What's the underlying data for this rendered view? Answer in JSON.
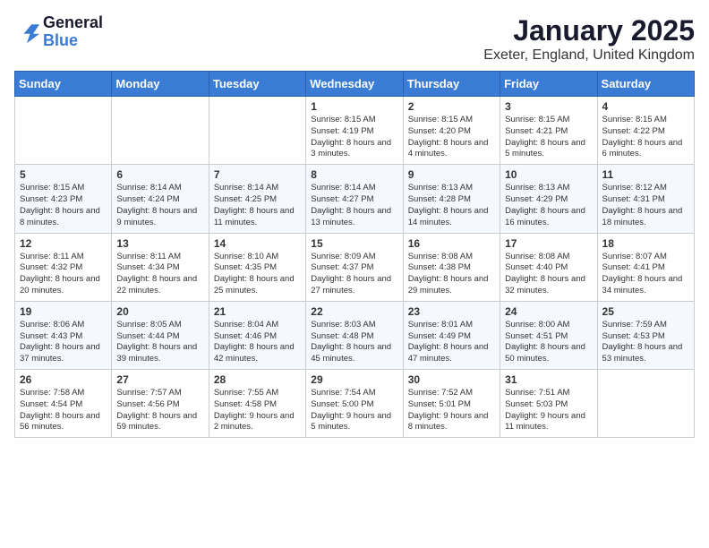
{
  "logo": {
    "general": "General",
    "blue": "Blue"
  },
  "title": {
    "month_year": "January 2025",
    "location": "Exeter, England, United Kingdom"
  },
  "days_of_week": [
    "Sunday",
    "Monday",
    "Tuesday",
    "Wednesday",
    "Thursday",
    "Friday",
    "Saturday"
  ],
  "weeks": [
    [
      {
        "day": "",
        "sunrise": "",
        "sunset": "",
        "daylight": ""
      },
      {
        "day": "",
        "sunrise": "",
        "sunset": "",
        "daylight": ""
      },
      {
        "day": "",
        "sunrise": "",
        "sunset": "",
        "daylight": ""
      },
      {
        "day": "1",
        "sunrise": "Sunrise: 8:15 AM",
        "sunset": "Sunset: 4:19 PM",
        "daylight": "Daylight: 8 hours and 3 minutes."
      },
      {
        "day": "2",
        "sunrise": "Sunrise: 8:15 AM",
        "sunset": "Sunset: 4:20 PM",
        "daylight": "Daylight: 8 hours and 4 minutes."
      },
      {
        "day": "3",
        "sunrise": "Sunrise: 8:15 AM",
        "sunset": "Sunset: 4:21 PM",
        "daylight": "Daylight: 8 hours and 5 minutes."
      },
      {
        "day": "4",
        "sunrise": "Sunrise: 8:15 AM",
        "sunset": "Sunset: 4:22 PM",
        "daylight": "Daylight: 8 hours and 6 minutes."
      }
    ],
    [
      {
        "day": "5",
        "sunrise": "Sunrise: 8:15 AM",
        "sunset": "Sunset: 4:23 PM",
        "daylight": "Daylight: 8 hours and 8 minutes."
      },
      {
        "day": "6",
        "sunrise": "Sunrise: 8:14 AM",
        "sunset": "Sunset: 4:24 PM",
        "daylight": "Daylight: 8 hours and 9 minutes."
      },
      {
        "day": "7",
        "sunrise": "Sunrise: 8:14 AM",
        "sunset": "Sunset: 4:25 PM",
        "daylight": "Daylight: 8 hours and 11 minutes."
      },
      {
        "day": "8",
        "sunrise": "Sunrise: 8:14 AM",
        "sunset": "Sunset: 4:27 PM",
        "daylight": "Daylight: 8 hours and 13 minutes."
      },
      {
        "day": "9",
        "sunrise": "Sunrise: 8:13 AM",
        "sunset": "Sunset: 4:28 PM",
        "daylight": "Daylight: 8 hours and 14 minutes."
      },
      {
        "day": "10",
        "sunrise": "Sunrise: 8:13 AM",
        "sunset": "Sunset: 4:29 PM",
        "daylight": "Daylight: 8 hours and 16 minutes."
      },
      {
        "day": "11",
        "sunrise": "Sunrise: 8:12 AM",
        "sunset": "Sunset: 4:31 PM",
        "daylight": "Daylight: 8 hours and 18 minutes."
      }
    ],
    [
      {
        "day": "12",
        "sunrise": "Sunrise: 8:11 AM",
        "sunset": "Sunset: 4:32 PM",
        "daylight": "Daylight: 8 hours and 20 minutes."
      },
      {
        "day": "13",
        "sunrise": "Sunrise: 8:11 AM",
        "sunset": "Sunset: 4:34 PM",
        "daylight": "Daylight: 8 hours and 22 minutes."
      },
      {
        "day": "14",
        "sunrise": "Sunrise: 8:10 AM",
        "sunset": "Sunset: 4:35 PM",
        "daylight": "Daylight: 8 hours and 25 minutes."
      },
      {
        "day": "15",
        "sunrise": "Sunrise: 8:09 AM",
        "sunset": "Sunset: 4:37 PM",
        "daylight": "Daylight: 8 hours and 27 minutes."
      },
      {
        "day": "16",
        "sunrise": "Sunrise: 8:08 AM",
        "sunset": "Sunset: 4:38 PM",
        "daylight": "Daylight: 8 hours and 29 minutes."
      },
      {
        "day": "17",
        "sunrise": "Sunrise: 8:08 AM",
        "sunset": "Sunset: 4:40 PM",
        "daylight": "Daylight: 8 hours and 32 minutes."
      },
      {
        "day": "18",
        "sunrise": "Sunrise: 8:07 AM",
        "sunset": "Sunset: 4:41 PM",
        "daylight": "Daylight: 8 hours and 34 minutes."
      }
    ],
    [
      {
        "day": "19",
        "sunrise": "Sunrise: 8:06 AM",
        "sunset": "Sunset: 4:43 PM",
        "daylight": "Daylight: 8 hours and 37 minutes."
      },
      {
        "day": "20",
        "sunrise": "Sunrise: 8:05 AM",
        "sunset": "Sunset: 4:44 PM",
        "daylight": "Daylight: 8 hours and 39 minutes."
      },
      {
        "day": "21",
        "sunrise": "Sunrise: 8:04 AM",
        "sunset": "Sunset: 4:46 PM",
        "daylight": "Daylight: 8 hours and 42 minutes."
      },
      {
        "day": "22",
        "sunrise": "Sunrise: 8:03 AM",
        "sunset": "Sunset: 4:48 PM",
        "daylight": "Daylight: 8 hours and 45 minutes."
      },
      {
        "day": "23",
        "sunrise": "Sunrise: 8:01 AM",
        "sunset": "Sunset: 4:49 PM",
        "daylight": "Daylight: 8 hours and 47 minutes."
      },
      {
        "day": "24",
        "sunrise": "Sunrise: 8:00 AM",
        "sunset": "Sunset: 4:51 PM",
        "daylight": "Daylight: 8 hours and 50 minutes."
      },
      {
        "day": "25",
        "sunrise": "Sunrise: 7:59 AM",
        "sunset": "Sunset: 4:53 PM",
        "daylight": "Daylight: 8 hours and 53 minutes."
      }
    ],
    [
      {
        "day": "26",
        "sunrise": "Sunrise: 7:58 AM",
        "sunset": "Sunset: 4:54 PM",
        "daylight": "Daylight: 8 hours and 56 minutes."
      },
      {
        "day": "27",
        "sunrise": "Sunrise: 7:57 AM",
        "sunset": "Sunset: 4:56 PM",
        "daylight": "Daylight: 8 hours and 59 minutes."
      },
      {
        "day": "28",
        "sunrise": "Sunrise: 7:55 AM",
        "sunset": "Sunset: 4:58 PM",
        "daylight": "Daylight: 9 hours and 2 minutes."
      },
      {
        "day": "29",
        "sunrise": "Sunrise: 7:54 AM",
        "sunset": "Sunset: 5:00 PM",
        "daylight": "Daylight: 9 hours and 5 minutes."
      },
      {
        "day": "30",
        "sunrise": "Sunrise: 7:52 AM",
        "sunset": "Sunset: 5:01 PM",
        "daylight": "Daylight: 9 hours and 8 minutes."
      },
      {
        "day": "31",
        "sunrise": "Sunrise: 7:51 AM",
        "sunset": "Sunset: 5:03 PM",
        "daylight": "Daylight: 9 hours and 11 minutes."
      },
      {
        "day": "",
        "sunrise": "",
        "sunset": "",
        "daylight": ""
      }
    ]
  ]
}
